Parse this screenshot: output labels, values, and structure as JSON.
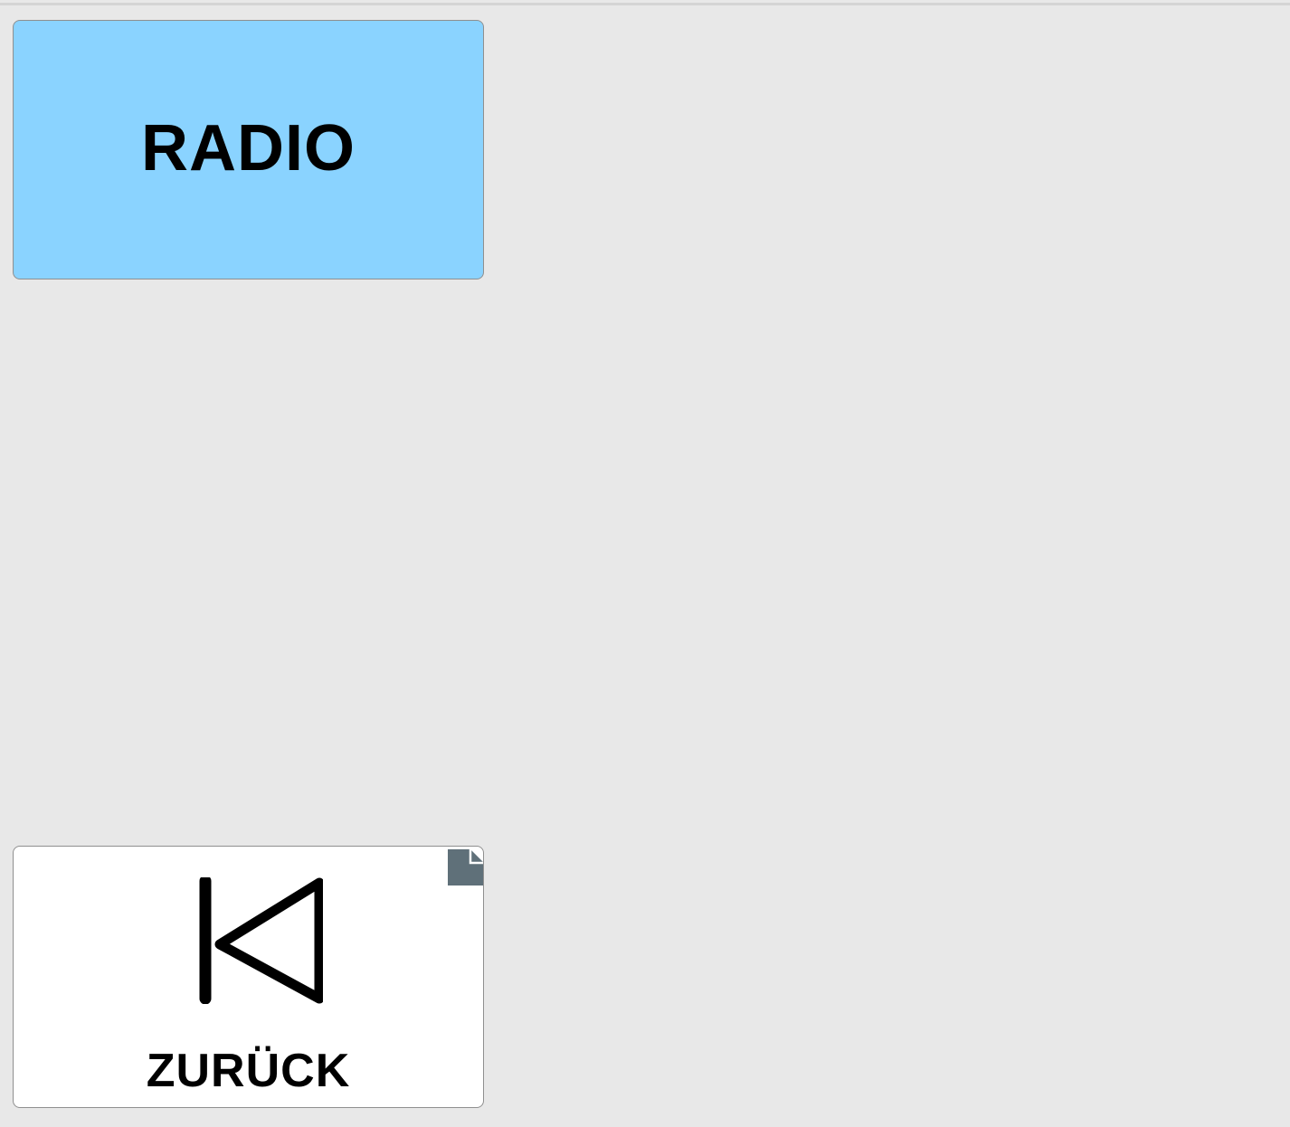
{
  "tiles": {
    "radio": {
      "label": "RADIO",
      "background": "#8ad3ff"
    },
    "back": {
      "label": "ZURÜCK",
      "icon": "skip-back-icon",
      "corner_icon": "page-icon",
      "background": "#ffffff"
    }
  },
  "colors": {
    "page_background": "#e8e8e8",
    "corner_icon": "#5f7079"
  }
}
